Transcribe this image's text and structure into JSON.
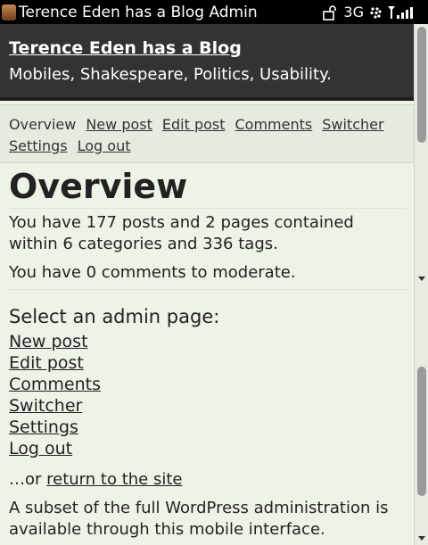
{
  "statusbar": {
    "title": "Terence Eden has a Blog Admin",
    "network": "3G"
  },
  "header": {
    "blog_title": "Terence Eden has a Blog",
    "tagline": "Mobiles, Shakespeare, Politics, Usability."
  },
  "nav": {
    "items": [
      {
        "label": "Overview"
      },
      {
        "label": "New post"
      },
      {
        "label": "Edit post"
      },
      {
        "label": "Comments"
      },
      {
        "label": "Switcher"
      },
      {
        "label": "Settings"
      },
      {
        "label": "Log out"
      }
    ]
  },
  "main": {
    "title": "Overview",
    "summary": "You have 177 posts and 2 pages contained within 6 categories and 336 tags.",
    "moderate": "You have 0 comments to moderate.",
    "select_heading": "Select an admin page:",
    "links": [
      {
        "label": "New post"
      },
      {
        "label": "Edit post"
      },
      {
        "label": "Comments"
      },
      {
        "label": "Switcher"
      },
      {
        "label": "Settings"
      },
      {
        "label": "Log out"
      }
    ],
    "return_prefix": "…or ",
    "return_link": "return to the site",
    "subset": "A subset of the full WordPress administration is available through this mobile interface."
  }
}
